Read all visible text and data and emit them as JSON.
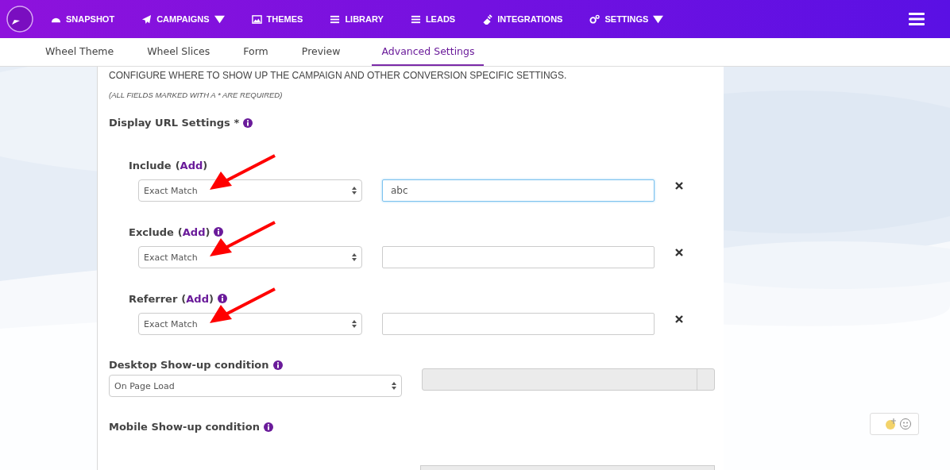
{
  "nav": {
    "items": [
      {
        "label": "SNAPSHOT",
        "dropdown": false
      },
      {
        "label": "CAMPAIGNS",
        "dropdown": true
      },
      {
        "label": "THEMES",
        "dropdown": false
      },
      {
        "label": "LIBRARY",
        "dropdown": false
      },
      {
        "label": "LEADS",
        "dropdown": false
      },
      {
        "label": "INTEGRATIONS",
        "dropdown": false
      },
      {
        "label": "SETTINGS",
        "dropdown": true
      }
    ]
  },
  "tabs": [
    {
      "label": "Wheel Theme",
      "selected": false
    },
    {
      "label": "Wheel Slices",
      "selected": false
    },
    {
      "label": "Form",
      "selected": false
    },
    {
      "label": "Preview",
      "selected": false
    },
    {
      "label": "Advanced Settings",
      "selected": true
    }
  ],
  "intro": "CONFIGURE WHERE TO SHOW UP THE CAMPAIGN AND OTHER CONVERSION SPECIFIC SETTINGS.",
  "required_note": "(ALL FIELDS MARKED WITH A * ARE REQUIRED)",
  "section_title": "Display URL Settings *",
  "rules": [
    {
      "label": "Include",
      "open": "(",
      "add": "Add",
      "close": ")",
      "info": false,
      "match": "Exact Match",
      "value": "abc",
      "focused": true,
      "annotated": true
    },
    {
      "label": "Exclude",
      "open": "(",
      "add": "Add",
      "close": ")",
      "info": true,
      "match": "Exact Match",
      "focused": false,
      "annotated": true
    },
    {
      "label": "Referrer",
      "open": "(",
      "add": "Add",
      "close": ")",
      "info": true,
      "match": "Exact Match",
      "focused": false,
      "annotated": true
    }
  ],
  "desktop": {
    "label": "Desktop Show-up condition",
    "select": "On Page Load"
  },
  "mobile": {
    "label": "Mobile Show-up condition"
  }
}
